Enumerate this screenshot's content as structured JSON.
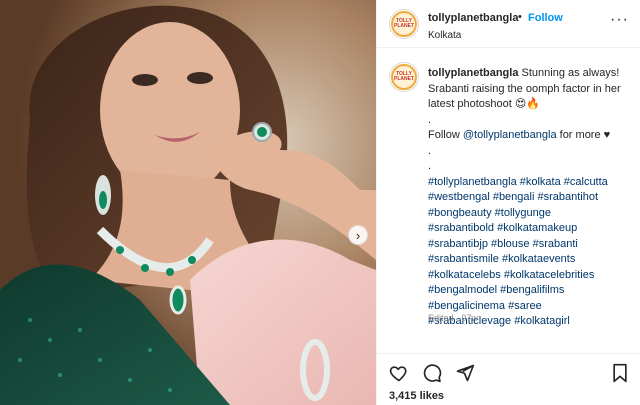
{
  "post": {
    "username": "tollyplanetbangla",
    "separator": "•",
    "follow_label": "Follow",
    "location": "Kolkata",
    "more_label": "···",
    "avatar_text": "TOLLY PLANET"
  },
  "caption": {
    "username": "tollyplanetbangla",
    "text_line1": "Stunning as always! Srabanti raising the oomph factor in her latest photoshoot 😍🔥",
    "dot1": ".",
    "follow_prefix": "Follow ",
    "follow_mention": "@tollyplanetbangla",
    "follow_suffix": " for more ♥",
    "dot2": ".",
    "dot3": ".",
    "hashtags": [
      "#tollyplanetbangla #kolkata #calcutta",
      "#westbengal #bengali #srabantihot",
      "#bongbeauty #tollygunge",
      "#srabantibold #kolkatamakeup",
      "#srabantibjp #blouse #srabanti",
      "#srabantismile #kolkataevents",
      "#kolkatacelebs #kolkatacelebrities",
      "#bengalmodel #bengalifilms",
      "#bengalicinema #saree",
      "#srabanticlevage #kolkatagirl"
    ],
    "edited": "Edited · 97w"
  },
  "actions": {
    "like_icon": "heart-icon",
    "comment_icon": "comment-icon",
    "share_icon": "send-icon",
    "save_icon": "bookmark-icon",
    "likes": "3,415 likes"
  },
  "carousel": {
    "next_label": "›"
  },
  "colors": {
    "link": "#00376b",
    "follow": "#0095f6",
    "muted": "#8e8e8e",
    "text": "#262626"
  }
}
